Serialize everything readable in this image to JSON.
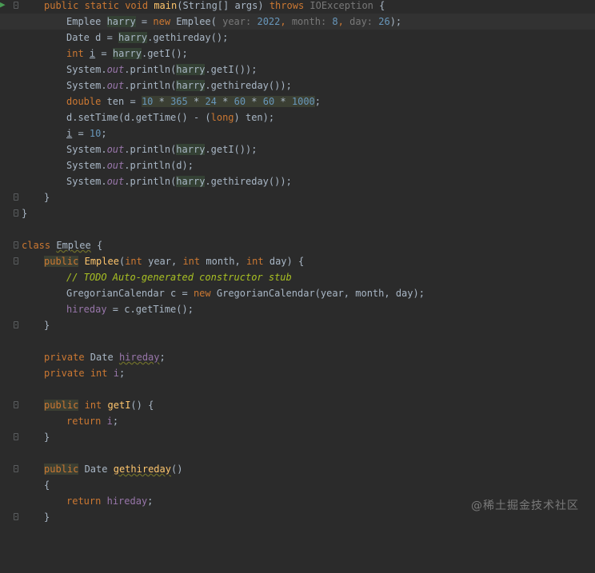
{
  "editor": {
    "theme_colors": {
      "background": "#2b2b2b",
      "keyword": "#cc7832",
      "function": "#ffc66d",
      "number": "#6897bb",
      "field": "#9876aa",
      "comment_todo": "#a8c023",
      "default_text": "#a9b7c6"
    },
    "lines": {
      "l00": {
        "kw_public": "public",
        "kw_static": "static",
        "kw_void": "void",
        "name": "main",
        "params": "(String[] args) ",
        "kw_throws": "throws",
        "exc": "IOException",
        "tail": " {"
      },
      "l01": {
        "type": "Emplee ",
        "var": "harry",
        "eq": " = ",
        "kw_new": "new",
        "ctor": " Emplee(",
        "h1": " year:",
        "v1": "2022",
        "c1": ",",
        "h2": " month:",
        "v2": "8",
        "c2": ",",
        "h3": " day:",
        "v3": "26",
        "tail": ");"
      },
      "l02": {
        "pre": "Date d = ",
        "var": "harry",
        "tail": ".gethireday();"
      },
      "l03": {
        "kw": "int",
        "sp": " ",
        "var": "i",
        "eq": " = ",
        "obj": "harry",
        "tail": ".getI();"
      },
      "l04": {
        "pre": "System.",
        "out": "out",
        "mid": ".println(",
        "var": "harry",
        "tail": ".getI());"
      },
      "l05": {
        "pre": "System.",
        "out": "out",
        "mid": ".println(",
        "var": "harry",
        "tail": ".gethireday());"
      },
      "l06": {
        "kw": "double",
        "mid": " ten = ",
        "n1": "10",
        "op1": " * ",
        "n2": "365",
        "op2": " * ",
        "n3": "24",
        "op3": " * ",
        "n4": "60",
        "op4": " * ",
        "n5": "60",
        "op5": " * ",
        "n6": "1000",
        "tail": ";"
      },
      "l07": {
        "pre": "d.setTime(d.getTime() - (",
        "kw": "long",
        "tail": ") ten);"
      },
      "l08": {
        "var": "i",
        "mid": " = ",
        "num": "10",
        "tail": ";"
      },
      "l09": {
        "pre": "System.",
        "out": "out",
        "mid": ".println(",
        "var": "harry",
        "tail": ".getI());"
      },
      "l10": {
        "pre": "System.",
        "out": "out",
        "tail": ".println(d);"
      },
      "l11": {
        "pre": "System.",
        "out": "out",
        "mid": ".println(",
        "var": "harry",
        "tail": ".gethireday());"
      },
      "l12": {
        "brace": "}"
      },
      "l13": {
        "brace": "}"
      },
      "l15": {
        "kw": "class",
        "sp": " ",
        "name": "Emplee",
        "tail": " {"
      },
      "l16": {
        "kw_public": "public",
        "sp": " ",
        "ctor": "Emplee",
        "p1": "(",
        "kw1": "int",
        "p2": " year, ",
        "kw2": "int",
        "p3": " month, ",
        "kw3": "int",
        "p4": " day) {"
      },
      "l17": {
        "comment": "// TODO Auto-generated constructor stub"
      },
      "l18": {
        "pre": "GregorianCalendar c = ",
        "kw": "new",
        "tail": " GregorianCalendar(year, month, day);"
      },
      "l19": {
        "field": "hireday",
        "tail": " = c.getTime();"
      },
      "l20": {
        "brace": "}"
      },
      "l22": {
        "kw": "private",
        "mid": " Date ",
        "field": "hireday",
        "tail": ";"
      },
      "l23": {
        "kw1": "private",
        "sp": " ",
        "kw2": "int",
        "mid": " ",
        "field": "i",
        "tail": ";"
      },
      "l25": {
        "kw_public": "public",
        "sp": " ",
        "kw_int": "int",
        "mid": " ",
        "name": "getI",
        "tail": "() {"
      },
      "l26": {
        "kw": "return",
        "mid": " ",
        "field": "i",
        "tail": ";"
      },
      "l27": {
        "brace": "}"
      },
      "l29": {
        "kw_public": "public",
        "mid": " Date ",
        "name": "gethireday",
        "tail": "()"
      },
      "l30": {
        "brace": "{"
      },
      "l31": {
        "kw": "return",
        "mid": " ",
        "field": "hireday",
        "tail": ";"
      },
      "l32": {
        "brace": "}"
      }
    }
  },
  "watermark": "@稀土掘金技术社区",
  "icons": {
    "run": "run-marker-icon",
    "fold": "fold-marker-icon"
  }
}
